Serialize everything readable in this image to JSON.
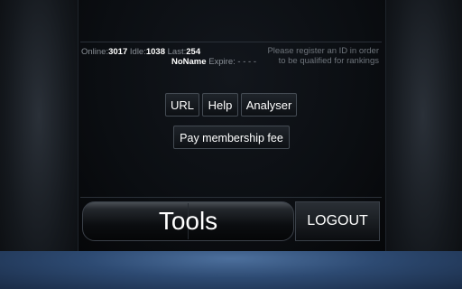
{
  "stats": {
    "online_label": "Online:",
    "online_value": "3017",
    "idle_label": "Idle:",
    "idle_value": "1038",
    "last_label": "Last:",
    "last_value": "254"
  },
  "user": {
    "name": "NoName",
    "expire_label": "Expire:",
    "expire_value": "- - - -"
  },
  "notice": {
    "line1": "Please register an ID in order",
    "line2": "to be qualified for rankings"
  },
  "buttons": {
    "url": "URL",
    "help": "Help",
    "analyser": "Analyser",
    "membership_fee": "Pay membership fee"
  },
  "bottom": {
    "tools": "Tools",
    "logout": "LOGOUT"
  }
}
